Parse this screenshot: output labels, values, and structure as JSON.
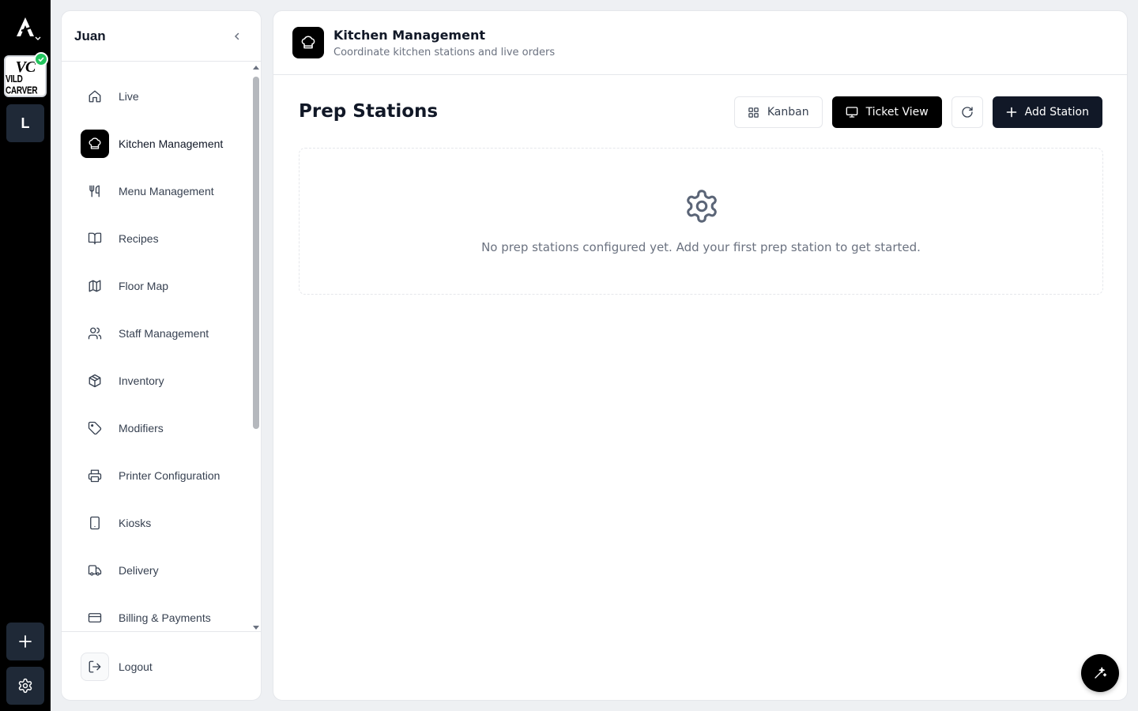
{
  "rail": {
    "logo_icon": "app-logo-icon",
    "brand": {
      "monogram": "VC",
      "name": "VILD CARVER"
    },
    "workspace_initial": "L",
    "add_icon": "plus-icon",
    "settings_icon": "gear-icon"
  },
  "sidebar": {
    "user_name": "Juan",
    "items": [
      {
        "label": "Live",
        "icon": "home-icon"
      },
      {
        "label": "Kitchen Management",
        "icon": "chef-hat-icon",
        "active": true
      },
      {
        "label": "Menu Management",
        "icon": "utensils-icon"
      },
      {
        "label": "Recipes",
        "icon": "book-icon"
      },
      {
        "label": "Floor Map",
        "icon": "map-icon"
      },
      {
        "label": "Staff Management",
        "icon": "users-icon"
      },
      {
        "label": "Inventory",
        "icon": "package-icon"
      },
      {
        "label": "Modifiers",
        "icon": "tag-icon"
      },
      {
        "label": "Printer Configuration",
        "icon": "printer-icon"
      },
      {
        "label": "Kiosks",
        "icon": "tablet-icon"
      },
      {
        "label": "Delivery",
        "icon": "truck-icon"
      },
      {
        "label": "Billing & Payments",
        "icon": "credit-card-icon"
      }
    ],
    "logout_label": "Logout"
  },
  "header": {
    "title": "Kitchen Management",
    "subtitle": "Coordinate kitchen stations and live orders"
  },
  "main": {
    "section_title": "Prep Stations",
    "buttons": {
      "kanban": "Kanban",
      "ticket_view": "Ticket View",
      "add_station": "Add Station"
    },
    "empty_message": "No prep stations configured yet. Add your first prep station to get started."
  },
  "colors": {
    "rail_bg": "#000000",
    "accent_dark": "#111827",
    "status_green": "#22c55e",
    "muted_text": "#6b7280"
  }
}
